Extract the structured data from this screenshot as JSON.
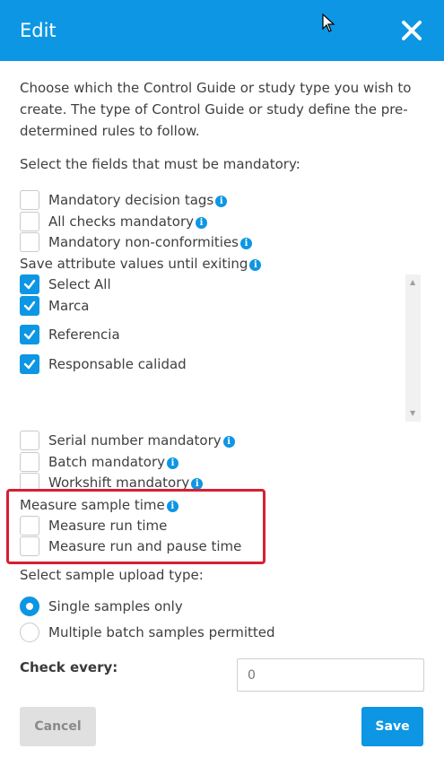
{
  "header": {
    "title": "Edit"
  },
  "intro": "Choose which the Control Guide or study type you wish to create. The type of Control Guide or study define the pre-determined rules to follow.",
  "mandatory_title": "Select the fields that must be mandatory:",
  "mandatory_options": [
    {
      "label": "Mandatory decision tags",
      "checked": false
    },
    {
      "label": "All checks mandatory",
      "checked": false
    },
    {
      "label": "Mandatory non-conformities",
      "checked": false
    }
  ],
  "save_attr_label": "Save attribute values until exiting",
  "attribute_options": [
    {
      "label": "Select All",
      "checked": true
    },
    {
      "label": "Marca",
      "checked": true
    },
    {
      "label": "Referencia",
      "checked": true
    },
    {
      "label": "Responsable calidad",
      "checked": true
    }
  ],
  "more_options": [
    {
      "label": "Serial number mandatory",
      "checked": false
    },
    {
      "label": "Batch mandatory",
      "checked": false
    },
    {
      "label": "Workshift mandatory",
      "checked": false
    }
  ],
  "measure_label": "Measure sample time",
  "measure_options": [
    {
      "label": "Measure run time",
      "checked": false
    },
    {
      "label": "Measure run and pause time",
      "checked": false
    }
  ],
  "upload_title": "Select sample upload type:",
  "upload_options": [
    {
      "label": "Single samples only",
      "selected": true
    },
    {
      "label": "Multiple batch samples permitted",
      "selected": false
    }
  ],
  "check_every": {
    "label": "Check every:",
    "placeholder": "0"
  },
  "buttons": {
    "cancel": "Cancel",
    "save": "Save"
  },
  "colors": {
    "accent": "#0d96e3",
    "highlight": "#d61f33"
  }
}
